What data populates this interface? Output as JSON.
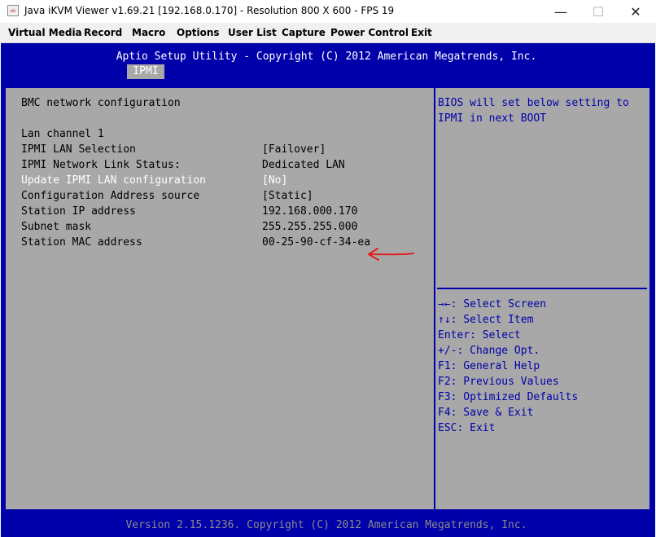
{
  "window": {
    "title": "Java iKVM Viewer v1.69.21 [192.168.0.170]  - Resolution 800 X 600 - FPS 19",
    "icon": "java-app-icon",
    "controls": {
      "minimize": "—",
      "maximize": "☐",
      "close": "✕"
    }
  },
  "menu": {
    "items": [
      "Virtual Media",
      "Record",
      "Macro",
      "Options",
      "User List",
      "Capture",
      "Power Control",
      "Exit"
    ]
  },
  "bios": {
    "header": "Aptio Setup Utility - Copyright (C) 2012 American Megatrends, Inc.",
    "active_tab": "IPMI",
    "section_title": "BMC network configuration",
    "channel": "Lan channel 1",
    "rows": [
      {
        "label": "IPMI LAN Selection",
        "value": "[Failover]",
        "highlight": false
      },
      {
        "label": "IPMI Network Link Status:",
        "value": "Dedicated LAN",
        "highlight": false
      },
      {
        "label": "Update IPMI LAN configuration",
        "value": "[No]",
        "highlight": true
      },
      {
        "label": "Configuration Address source",
        "value": "[Static]",
        "highlight": false
      },
      {
        "label": "Station IP address",
        "value": "192.168.000.170",
        "highlight": false
      },
      {
        "label": "Subnet mask",
        "value": "255.255.255.000",
        "highlight": false
      },
      {
        "label": "Station MAC address",
        "value": "00-25-90-cf-34-ea",
        "highlight": false
      }
    ],
    "help": [
      "BIOS will set below setting to",
      "IPMI in next BOOT"
    ],
    "keys": [
      "→←: Select Screen",
      "↑↓: Select Item",
      "Enter: Select",
      "+/-: Change Opt.",
      "F1: General Help",
      "F2: Previous Values",
      "F3: Optimized Defaults",
      "F4: Save & Exit",
      "ESC: Exit"
    ],
    "footer": "Version 2.15.1236. Copyright (C) 2012 American Megatrends, Inc."
  },
  "colors": {
    "bios_blue": "#0000aa",
    "bios_gray": "#a8a8a8",
    "annotation_red": "#e02020"
  }
}
